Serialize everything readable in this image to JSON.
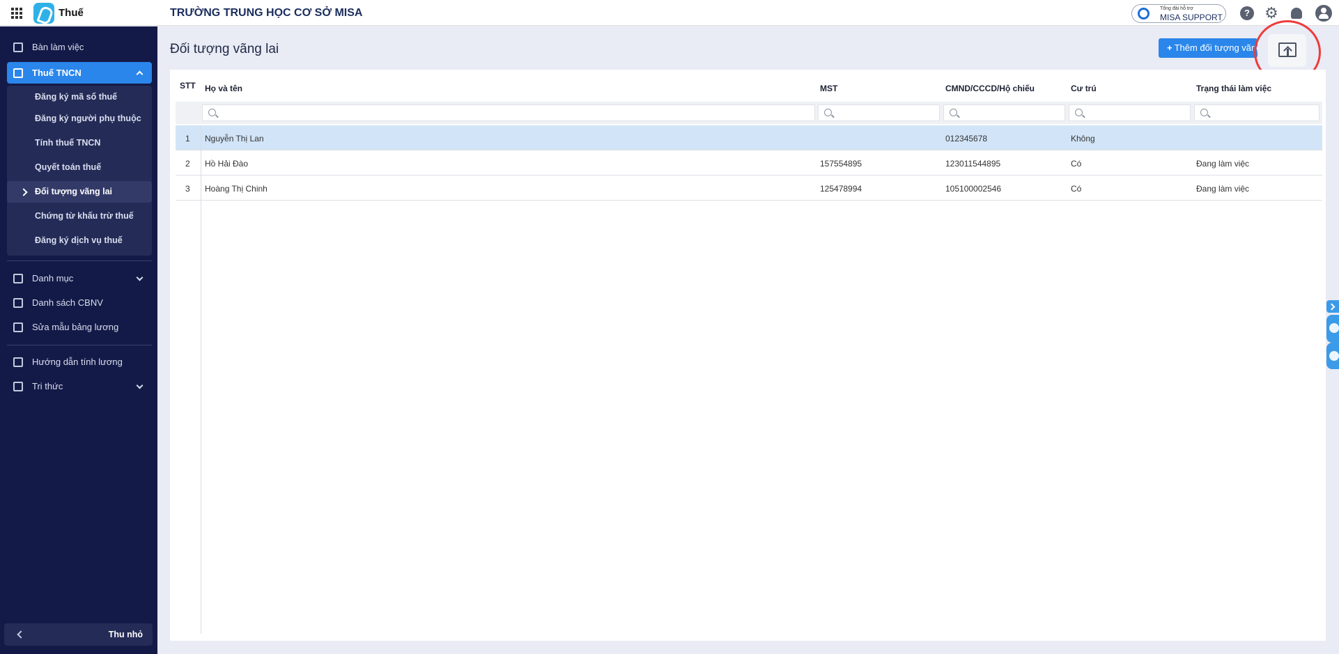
{
  "topbar": {
    "app_name": "Thuế",
    "org_name": "TRƯỜNG TRUNG HỌC CƠ SỞ MISA",
    "support_small": "Tổng đài hỗ trợ",
    "support_label": "MISA SUPPORT",
    "icons": [
      "apps-grid-icon",
      "help-icon",
      "gear-icon",
      "bell-icon",
      "user-icon"
    ]
  },
  "sidebar": {
    "items": [
      {
        "label": "Bàn làm việc",
        "icon": "dashboard-icon"
      },
      {
        "label": "Thuế TNCN",
        "icon": "tax-icon",
        "expanded": true
      },
      {
        "label": "Danh mục",
        "icon": "list-icon"
      },
      {
        "label": "Danh sách CBNV",
        "icon": "employee-card-icon"
      },
      {
        "label": "Sửa mẫu bảng lương",
        "icon": "document-settings-icon"
      },
      {
        "label": "Hướng dẫn tính lương",
        "icon": "guide-icon"
      },
      {
        "label": "Tri thức",
        "icon": "knowledge-cube-icon"
      }
    ],
    "submenu": [
      "Đăng ký mã số thuế",
      "Đăng ký người phụ thuộc",
      "Tính thuế TNCN",
      "Quyết toán thuế",
      "Đối tượng vãng lai",
      "Chứng từ khấu trừ thuế",
      "Đăng ký dịch vụ thuế"
    ],
    "current_submenu": "Đối tượng vãng lai",
    "collapse_label": "Thu nhỏ"
  },
  "main": {
    "title": "Đối tượng vãng lai",
    "add_button": "Thêm đối tượng vãng lai",
    "export_icon": "export-upload-icon"
  },
  "table": {
    "headers": [
      "STT",
      "Họ và tên",
      "MST",
      "CMND/CCCD/Hộ chiếu",
      "Cư trú",
      "Trạng thái làm việc"
    ],
    "rows": [
      {
        "stt": "1",
        "name": "Nguyễn Thị Lan",
        "mst": "",
        "id": "012345678",
        "residence": "Không",
        "status": ""
      },
      {
        "stt": "2",
        "name": "Hồ Hải Đào",
        "mst": "157554895",
        "id": "123011544895",
        "residence": "Có",
        "status": "Đang làm việc"
      },
      {
        "stt": "3",
        "name": "Hoàng Thị Chinh",
        "mst": "125478994",
        "id": "105100002546",
        "residence": "Có",
        "status": "Đang làm việc"
      }
    ]
  },
  "colors": {
    "sidebar_bg": "#141a47",
    "accent": "#2a86ea",
    "selected_row": "#d2e4f7",
    "highlight_circle": "#ee3b3b"
  }
}
